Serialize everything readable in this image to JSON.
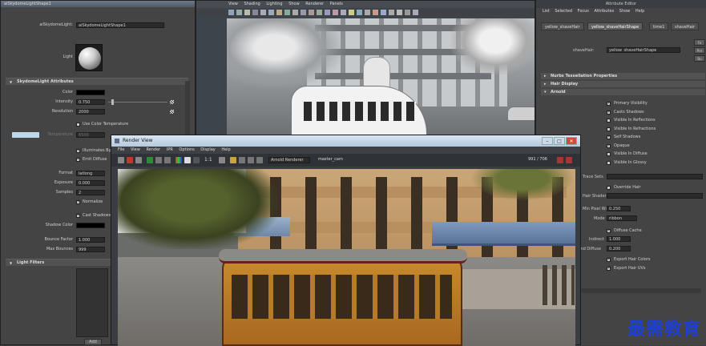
{
  "left_panel": {
    "title": "aiSkydomeLightShape1",
    "light_label": "aiSkydomeLight:",
    "light_value": "aiSkydomeLightShape1",
    "preview_label": "Light",
    "section_title": "SkydomeLight Attributes",
    "fields": [
      {
        "label": "Color",
        "value": ""
      },
      {
        "label": "Intensity",
        "value": "0.750"
      },
      {
        "label": "Resolution",
        "value": "2000"
      }
    ],
    "use_color_temp": "Use Color Temperature",
    "temperature_label": "Temperature",
    "temperature_value": "6500",
    "illuminates": "Illuminates By",
    "emit_diffuse": "Emit Diffuse",
    "format_label": "Format",
    "format_value": "latlong",
    "exposure_label": "Exposure",
    "exposure_value": "0.000",
    "samples_label": "Samples",
    "samples_value": "2",
    "normalize": "Normalize",
    "cast_shadows": "Cast Shadows",
    "shadow_color_label": "Shadow Color",
    "bounce_factor_label": "Bounce Factor",
    "bounce_factor_value": "1.000",
    "max_bounces_label": "Max Bounces",
    "max_bounces_value": "999",
    "light_filters": "Light Filters",
    "add_button": "Add"
  },
  "viewport": {
    "menu": [
      "View",
      "Shading",
      "Lighting",
      "Show",
      "Renderer",
      "Panels"
    ]
  },
  "right_panel": {
    "header": "Attribute Editor",
    "menu": [
      "List",
      "Selected",
      "Focus",
      "Attributes",
      "Show",
      "Help"
    ],
    "tabs": [
      "yellow_shaveHair",
      "yellow_shaveHairShape",
      "time1",
      "shaveHair"
    ],
    "shavehair_label": "shaveHair:",
    "shavehair_value": "yellow_shaveHairShape",
    "side_buttons": [
      "Fo",
      "Pre",
      "Bu"
    ],
    "sections": [
      "Nurbs Tessellation Properties",
      "Hair Display",
      "Arnold"
    ],
    "checks": [
      {
        "label": "Primary Visibility",
        "on": true
      },
      {
        "label": "Casts Shadows",
        "on": true
      },
      {
        "label": "Visible In Reflections",
        "on": false
      },
      {
        "label": "Visible In Refractions",
        "on": false
      },
      {
        "label": "Self Shadows",
        "on": true
      },
      {
        "label": "Opaque",
        "on": true
      },
      {
        "label": "Visible In Diffuse",
        "on": false
      },
      {
        "label": "Visible In Glossy",
        "on": false
      }
    ],
    "trace_sets": "Trace Sets",
    "override_hair": "Override Hair",
    "hair_shader": "Hair Shader",
    "min_pixel_width_label": "Min Pixel Width",
    "min_pixel_width_value": "0.250",
    "mode_label": "Mode",
    "mode_value": "ribbon",
    "diffuse_cache": "Diffuse Cache",
    "indirect_label": "Indirect",
    "indirect_value": "1.000",
    "ind_diffuse_label": "Ind Diffuse",
    "ind_diffuse_value": "0.200",
    "export_hair_colors": "Export Hair Colors",
    "export_hair_uvs": "Export Hair UVs"
  },
  "render_view": {
    "title": "Render View",
    "menu": [
      "File",
      "View",
      "Render",
      "IPR",
      "Options",
      "Display",
      "Help"
    ],
    "renderer": "Arnold Renderer",
    "camera": "master_cam",
    "zoom": "1:1",
    "size": "991 / 706"
  },
  "watermark": "最需教育",
  "colors": {
    "accent": "#1f3fd0",
    "panel": "#444444"
  }
}
